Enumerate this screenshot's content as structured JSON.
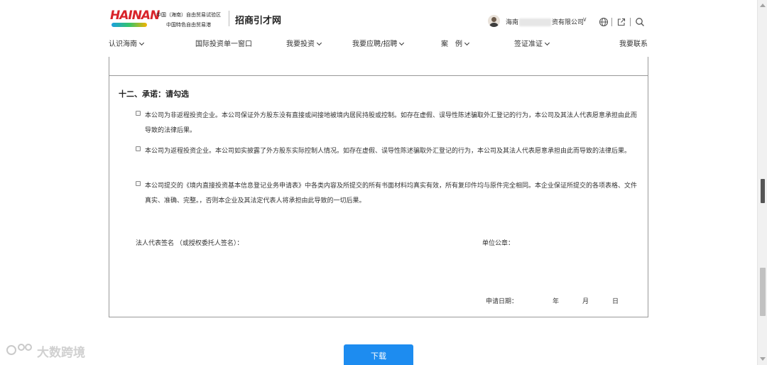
{
  "header": {
    "logo_text": "HAINAN",
    "org_line1": "中国（海南）自由贸易试验区",
    "org_line2": "中国特色自由贸易港",
    "site_name": "招商引才网",
    "company_prefix": "海南",
    "company_suffix": "资有限公司"
  },
  "nav": {
    "items": [
      {
        "label": "认识海南",
        "has_dropdown": true
      },
      {
        "label": "国际投资单一窗口",
        "has_dropdown": false
      },
      {
        "label": "我要投资",
        "has_dropdown": true
      },
      {
        "label": "我要应聘/招聘",
        "has_dropdown": true
      },
      {
        "label": "案　例",
        "has_dropdown": true
      },
      {
        "label": "签证准证",
        "has_dropdown": true
      },
      {
        "label": "我要联系",
        "has_dropdown": false
      }
    ]
  },
  "form": {
    "section_title": "十二、承诺：请勾选",
    "options": [
      {
        "text": "本公司为非返程投资企业。本公司保证外方股东没有直接或间接地被境内居民持股或控制。如存在虚假、误导性陈述骗取外汇登记的行为，本公司及其法人代表愿意承担由此而导致的法律后果。",
        "checked": false
      },
      {
        "text": "本公司为返程投资企业。本公司如实披露了外方股东实际控制人情况。如存在虚假、误导性陈述骗取外汇登记的行为，本公司及其法人代表愿意承担由此而导致的法律后果。",
        "checked": false
      },
      {
        "text": "本公司提交的《境内直接投资基本信息登记业务申请表》中各类内容及所提交的所有书面材料均真实有效，所有复印件均与原件完全相同。本企业保证所提交的各项表格、文件真实、准确、完整。，否则本企业及其法定代表人将承担由此导致的一切后果。",
        "checked": false
      }
    ],
    "legal_rep_label": "法人代表签名 （或授权委托人签名）：",
    "seal_label": "单位公章：",
    "date_label": "申请日期：",
    "year": "年",
    "month": "月",
    "day": "日"
  },
  "actions": {
    "download_label": "下载"
  },
  "watermark": {
    "text": "大数跨境"
  },
  "colors": {
    "primary": "#1d8cf0",
    "logo_red": "#d8232a",
    "border": "#999999"
  }
}
